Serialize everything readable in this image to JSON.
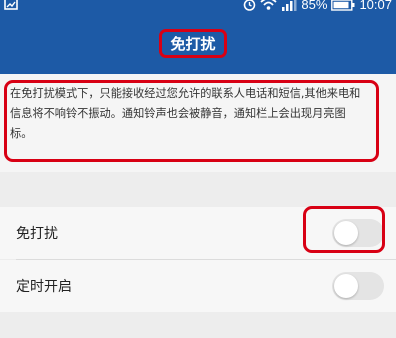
{
  "status_bar": {
    "battery": "85%",
    "time": "10:07",
    "icons": [
      "image-icon",
      "alarm-icon",
      "wifi-icon",
      "signal-icon",
      "battery-icon"
    ]
  },
  "header": {
    "title": "免打扰"
  },
  "description": {
    "text": "在免打扰模式下，只能接收经过您允许的联系人电话和短信,其他来电和信息将不响铃不振动。通知铃声也会被静音，通知栏上会出现月亮图标。"
  },
  "settings": [
    {
      "label": "免打扰",
      "enabled": false
    },
    {
      "label": "定时开启",
      "enabled": false
    }
  ],
  "colors": {
    "header_bg": "#1d5aa6",
    "highlight": "#d80014",
    "toggle_off": "#e4e4e4"
  }
}
